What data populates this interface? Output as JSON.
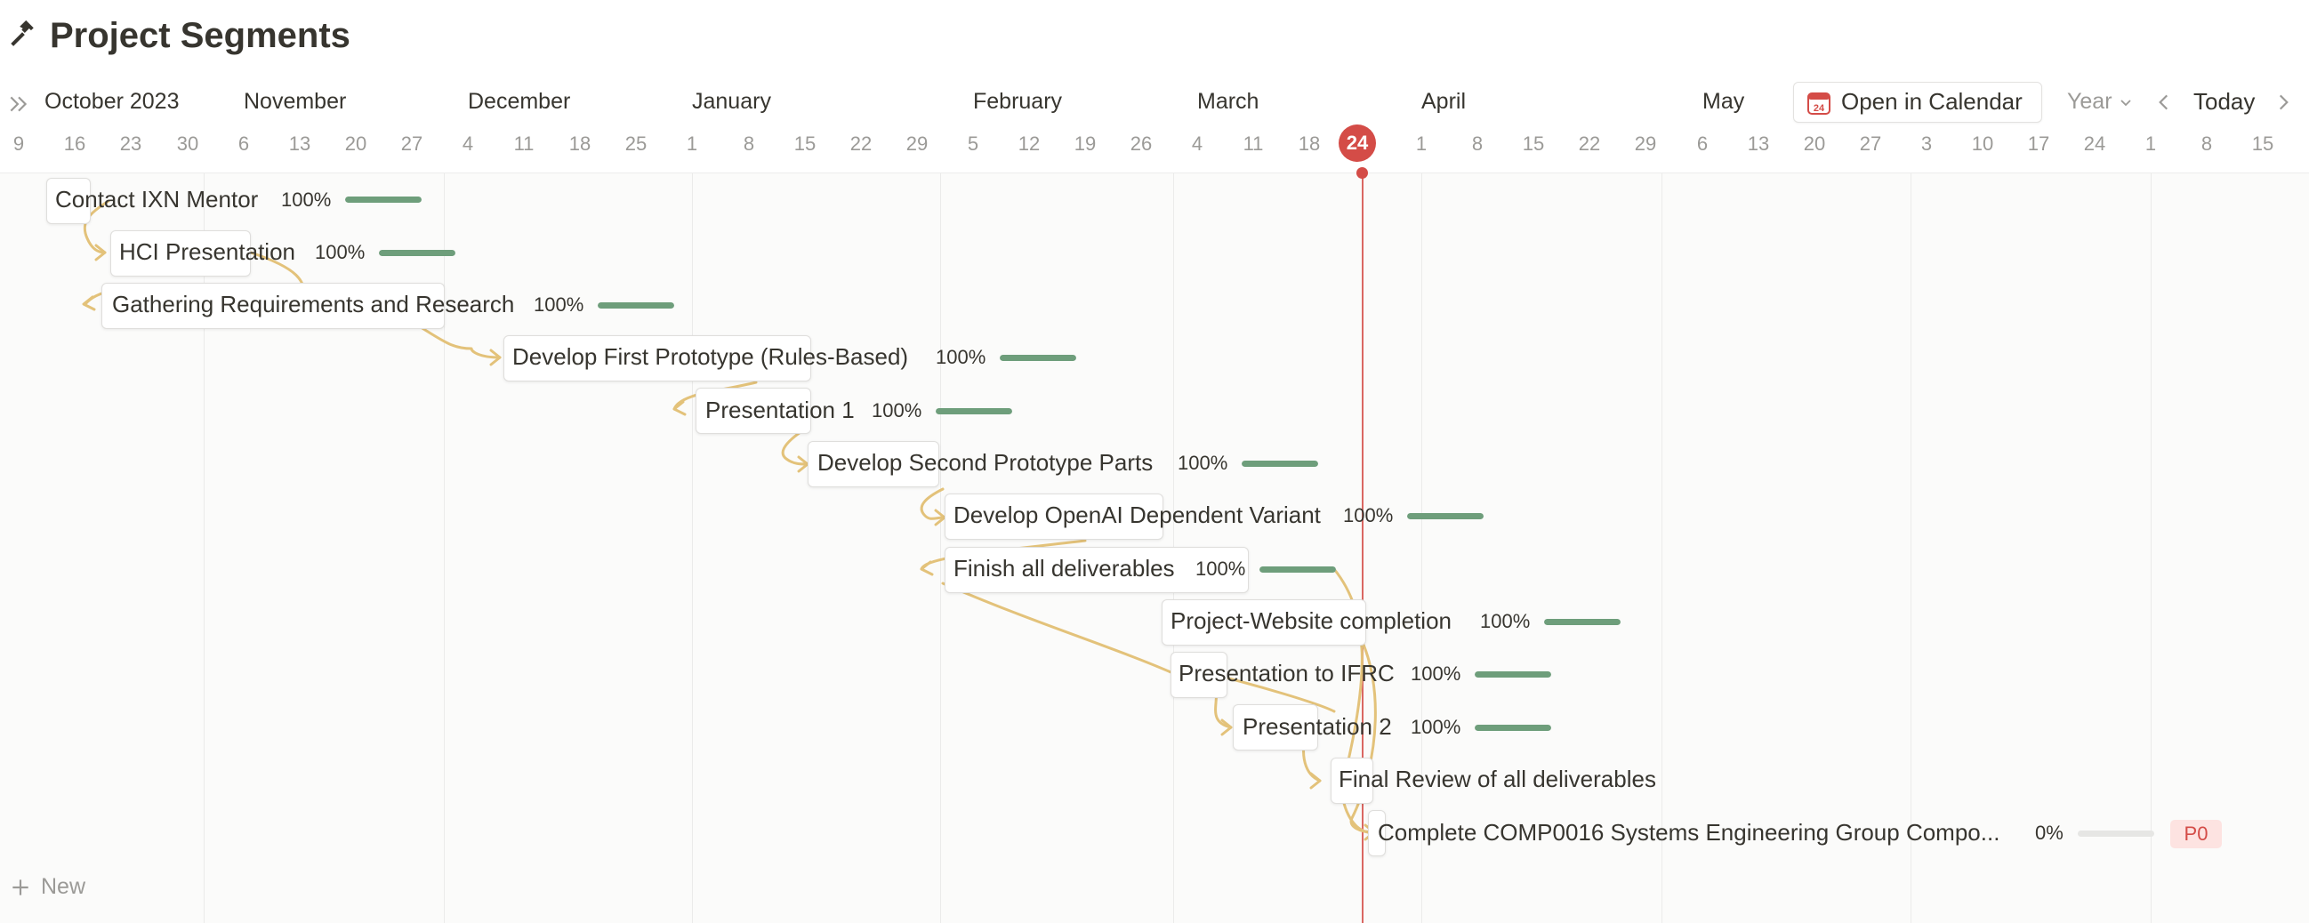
{
  "page": {
    "title": "Project Segments",
    "title_icon": "hammer-icon"
  },
  "toolbar": {
    "open_calendar_label": "Open in Calendar",
    "open_calendar_icon": "calendar-icon",
    "calendar_icon_day": "24",
    "view_select": "Year",
    "today_label": "Today"
  },
  "timeline": {
    "months": [
      "October 2023",
      "November",
      "December",
      "January",
      "February",
      "March",
      "April",
      "May"
    ],
    "days": [
      "9",
      "16",
      "23",
      "30",
      "6",
      "13",
      "20",
      "27",
      "4",
      "11",
      "18",
      "25",
      "1",
      "8",
      "15",
      "22",
      "29",
      "5",
      "12",
      "19",
      "26",
      "4",
      "11",
      "18",
      "24",
      "1",
      "8",
      "15",
      "22",
      "29",
      "6",
      "13",
      "20",
      "27",
      "3",
      "10",
      "17",
      "24",
      "1",
      "8",
      "15"
    ],
    "today": "24"
  },
  "tasks": [
    {
      "name": "Contact IXN Mentor",
      "progress": "100%",
      "progress_value": 1.0
    },
    {
      "name": "HCI Presentation",
      "progress": "100%",
      "progress_value": 1.0
    },
    {
      "name": "Gathering Requirements and Research",
      "progress": "100%",
      "progress_value": 1.0
    },
    {
      "name": "Develop First Prototype (Rules-Based)",
      "progress": "100%",
      "progress_value": 1.0
    },
    {
      "name": "Presentation 1",
      "progress": "100%",
      "progress_value": 1.0
    },
    {
      "name": "Develop Second Prototype Parts",
      "progress": "100%",
      "progress_value": 1.0
    },
    {
      "name": "Develop OpenAI Dependent Variant",
      "progress": "100%",
      "progress_value": 1.0
    },
    {
      "name": "Finish all deliverables",
      "progress": "100%",
      "progress_value": 1.0
    },
    {
      "name": "Project-Website completion",
      "progress": "100%",
      "progress_value": 1.0
    },
    {
      "name": "Presentation to IFRC",
      "progress": "100%",
      "progress_value": 1.0
    },
    {
      "name": "Presentation 2",
      "progress": "100%",
      "progress_value": 1.0
    },
    {
      "name": "Final Review of all deliverables",
      "progress": "",
      "progress_value": null
    },
    {
      "name": "Complete COMP0016 Systems Engineering Group Compo...",
      "progress": "0%",
      "progress_value": 0.0,
      "priority": "P0"
    }
  ],
  "new_item": {
    "label": "New"
  },
  "colors": {
    "accent_today": "#d44c47",
    "progress_fill": "#6e9e7b",
    "dependency_line": "#e3c27a",
    "priority_bg": "#fde3e1",
    "priority_text": "#d44c47"
  }
}
